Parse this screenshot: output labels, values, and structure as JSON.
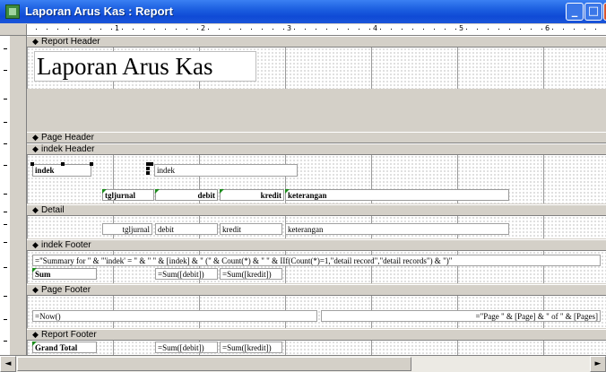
{
  "window": {
    "title": "Laporan Arus Kas : Report",
    "buttons": {
      "minimize": "_",
      "maximize": "□",
      "close": "X"
    }
  },
  "ruler": {
    "numbers": [
      "1",
      "2",
      "3",
      "4",
      "5",
      "6"
    ]
  },
  "sections": {
    "report_header": "Report Header",
    "page_header": "Page Header",
    "indek_header": "indek Header",
    "detail": "Detail",
    "indek_footer": "indek Footer",
    "page_footer": "Page Footer",
    "report_footer": "Report Footer"
  },
  "report_header": {
    "title_label": "Laporan Arus Kas"
  },
  "indek_header": {
    "indek_label": "indek",
    "indek_field": "indek",
    "col_tgljurnal": "tgljurnal",
    "col_debit": "debit",
    "col_kredit": "kredit",
    "col_keterangan": "keterangan"
  },
  "detail": {
    "tgljurnal": "tgljurnal",
    "debit": "debit",
    "kredit": "kredit",
    "keterangan": "keterangan"
  },
  "indek_footer": {
    "summary_expr": "=\"Summary for \" & \"'indek' = \" & \" \" & [indek] & \" (\" & Count(*) & \" \" & IIf(Count(*)=1,\"detail record\",\"detail records\") & \")\"",
    "sum_label": "Sum",
    "sum_debit": "=Sum([debit])",
    "sum_kredit": "=Sum([kredit])"
  },
  "page_footer": {
    "now": "=Now()",
    "page_expr": "=\"Page \" & [Page] & \" of \" & [Pages]"
  },
  "report_footer": {
    "grand_total_label": "Grand Total",
    "sum_debit": "=Sum([debit])",
    "sum_kredit": "=Sum([kredit])"
  },
  "icons": {
    "section_marker": "section-marker-icon",
    "scroll_left": "◄",
    "scroll_right": "►"
  }
}
